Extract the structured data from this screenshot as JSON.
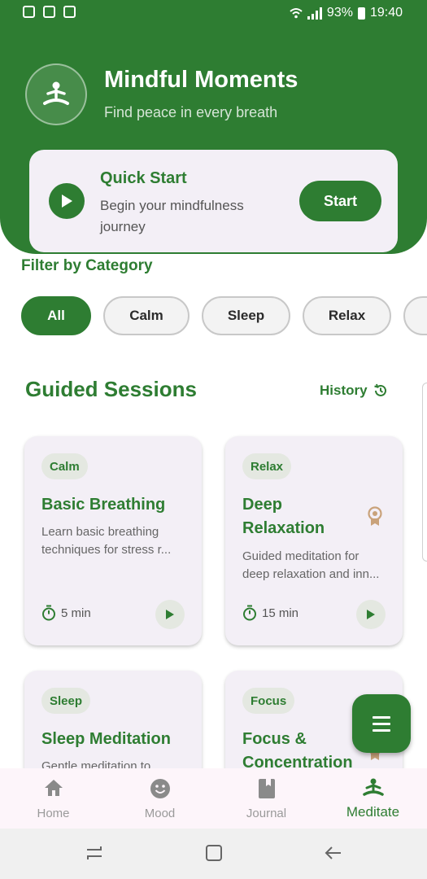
{
  "status_bar": {
    "battery": "93%",
    "time": "19:40"
  },
  "header": {
    "title": "Mindful Moments",
    "subtitle": "Find peace in every breath"
  },
  "quick_start": {
    "title": "Quick Start",
    "description": "Begin your mindfulness journey",
    "button_label": "Start"
  },
  "filter": {
    "title": "Filter by Category",
    "chips": [
      "All",
      "Calm",
      "Sleep",
      "Relax"
    ],
    "selected": "All"
  },
  "sessions": {
    "title": "Guided Sessions",
    "history_label": "History",
    "cards": [
      {
        "category": "Calm",
        "title": "Basic Breathing",
        "description_line1": "Learn basic breathing",
        "description_line2": "techniques for stress r...",
        "duration": "5 min"
      },
      {
        "category": "Relax",
        "title": "Deep Relaxation",
        "description_line1": "Guided meditation for",
        "description_line2": "deep relaxation and inn...",
        "duration": "15 min",
        "award_icon": "award-icon"
      },
      {
        "category": "Sleep",
        "title": "Sleep Meditation",
        "description_line1": "Gentle meditation to"
      },
      {
        "category": "Focus",
        "title": "Focus & Concentration"
      }
    ]
  },
  "bottom_nav": {
    "items": [
      {
        "label": "Home",
        "icon": "home-icon"
      },
      {
        "label": "Mood",
        "icon": "mood-icon"
      },
      {
        "label": "Journal",
        "icon": "book-icon"
      },
      {
        "label": "Meditate",
        "icon": "meditate-icon"
      }
    ],
    "active": "Meditate"
  },
  "colors": {
    "primary": "#2e7d32",
    "card_bg": "#f3eff6",
    "nav_bg": "#fdf5fa",
    "award": "#c9a27a"
  }
}
